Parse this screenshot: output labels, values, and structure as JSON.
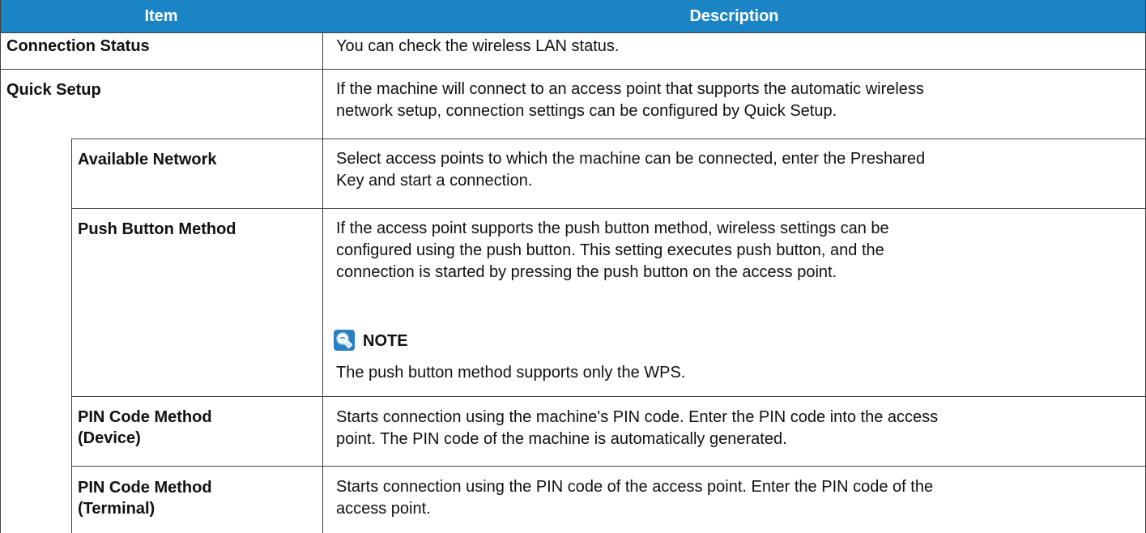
{
  "header": {
    "item": "Item",
    "description": "Description"
  },
  "rows": [
    {
      "item": "Connection Status",
      "description": [
        "You can check the wireless LAN status."
      ]
    },
    {
      "item": "Quick Setup",
      "description": [
        "If the machine will connect to an access point that supports the automatic wireless",
        "network setup, connection settings can be configured by Quick Setup."
      ]
    },
    {
      "item": "Available Network",
      "description": [
        "Select access points to which the machine can be connected, enter the Preshared",
        "Key and start a connection."
      ]
    },
    {
      "item": "Push Button Method",
      "description": [
        "If the access point supports the push button method, wireless settings can be",
        "configured using the push button. This setting executes push button, and the",
        "connection is started by pressing the push button on the access point."
      ],
      "note_label": "NOTE",
      "note_text": "The push button method supports only the WPS."
    },
    {
      "item_lines": [
        "PIN Code Method",
        "(Device)"
      ],
      "description": [
        "Starts connection using the machine's PIN code. Enter the PIN code into the access",
        "point. The PIN code of the machine is automatically generated."
      ]
    },
    {
      "item_lines": [
        "PIN Code Method",
        "(Terminal)"
      ],
      "description": [
        "Starts connection using the PIN code of the access point. Enter the PIN code of the",
        "access point."
      ]
    }
  ],
  "colors": {
    "header_bg": "#1b84c4",
    "header_text": "#ffffff",
    "rule": "#404040"
  },
  "icons": {
    "note": "note-lightbulb-icon"
  }
}
